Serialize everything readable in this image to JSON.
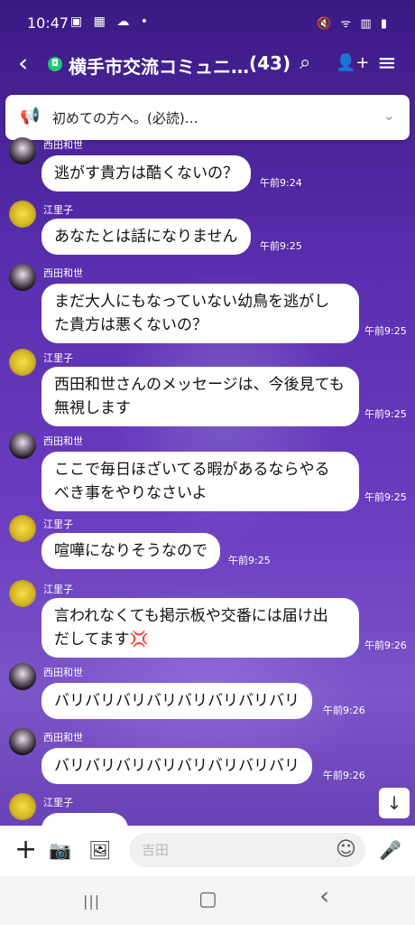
{
  "status_bar": {
    "time": "10:47",
    "left_icons": "▣ ▦ ☁ •",
    "right_icons": "🔇 ᯤ ▥ ▮"
  },
  "header": {
    "back_icon": "‹",
    "group_badge": "◘",
    "title": "横手市交流コミュニ…",
    "member_count": "(43)",
    "search_icon": "⌕",
    "add_friend_icon": "👤+",
    "menu_icon": "≡"
  },
  "announcement": {
    "icon": "📢",
    "text": "初めての方へ。(必読)…",
    "chevron": "⌄"
  },
  "messages": [
    {
      "name": "西田和世",
      "text": "逃がす貴方は酷くないの？",
      "time": "午前9:24"
    },
    {
      "name": "江里子",
      "text": "あなたとは話になりません",
      "time": "午前9:25"
    },
    {
      "name": "西田和世",
      "line1": "まだ大人にもなっていない幼鳥を逃がし",
      "line2": "た貴方は悪くないの？",
      "time": "午前9:25"
    },
    {
      "name": "江里子",
      "line1": "西田和世さんのメッセージは、今後見ても",
      "line2": "無視します",
      "time": "午前9:25"
    },
    {
      "name": "西田和世",
      "line1": "ここで毎日ほざいてる暇があるならやる",
      "line2": "べき事をやりなさいよ",
      "time": "午前9:25"
    },
    {
      "name": "江里子",
      "text": "喧嘩になりそうなので",
      "time": "午前9:25"
    },
    {
      "name": "江里子",
      "line1": "言われなくても掲示板や交番には届け出",
      "line2": "だしてます💢",
      "time": "午前9:26"
    },
    {
      "name": "西田和世",
      "text": "バリバリバリバリバリバリバリバリ",
      "time": "午前9:26"
    },
    {
      "name": "西田和世",
      "text": "バリバリバリバリバリバリバリバリ",
      "time": "午前9:26"
    },
    {
      "name": "江里子",
      "text": "・・・・",
      "time": ""
    }
  ],
  "scroll_down_icon": "↓",
  "input_bar": {
    "plus_icon": "+",
    "camera_icon": "📷",
    "image_icon": "🖼",
    "placeholder": "吉田",
    "emoji_icon": "☺",
    "mic_icon": "🎤"
  },
  "nav_bar": {
    "recents_icon": "|||",
    "home_icon": "▢",
    "back_icon": "‹"
  }
}
